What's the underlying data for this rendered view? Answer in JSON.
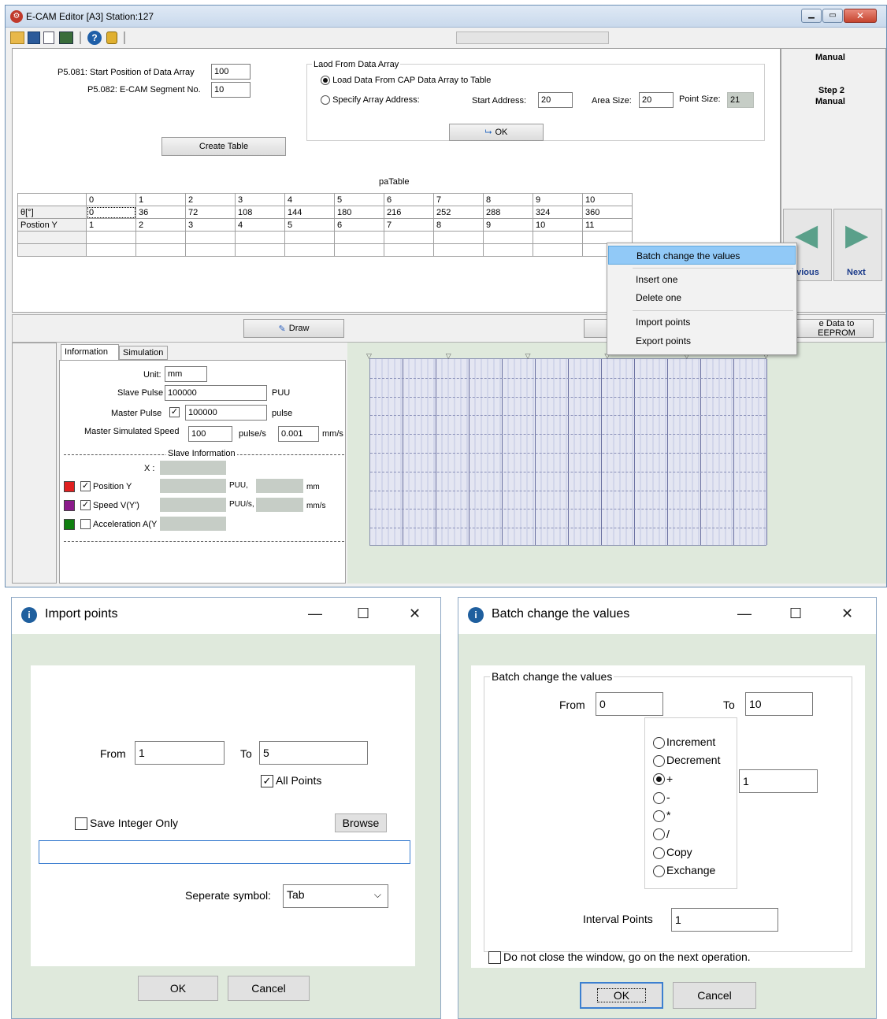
{
  "main": {
    "title": "E-CAM Editor [A3] Station:127",
    "p5081_label": "P5.081: Start Position of Data Array",
    "p5081_value": "100",
    "p5082_label": "P5.082: E-CAM Segment No.",
    "p5082_value": "10",
    "create_table": "Create Table",
    "load_group_title": "Laod From Data Array",
    "load_cap_label": "Load Data From CAP Data Array to Table",
    "specify_label": "Specify Array Address:",
    "start_addr_label": "Start Address:",
    "start_addr_value": "20",
    "area_size_label": "Area Size:",
    "area_size_value": "20",
    "point_size_label": "Point Size:",
    "point_size_value": "21",
    "ok_label": "OK",
    "right_panel_title": "Manual",
    "step_title": "Step 2",
    "step_sub": "Manual",
    "previous_label": "evious",
    "next_label": "Next",
    "table_title": "paTable",
    "draw_label": "Draw",
    "eeprom_label": "e Data to EEPROM"
  },
  "table": {
    "columns": [
      "0",
      "1",
      "2",
      "3",
      "4",
      "5",
      "6",
      "7",
      "8",
      "9",
      "10"
    ],
    "row1_label": "θ[°]",
    "row1": [
      "0",
      "36",
      "72",
      "108",
      "144",
      "180",
      "216",
      "252",
      "288",
      "324",
      "360"
    ],
    "row2_label": "Postion Y",
    "row2": [
      "1",
      "2",
      "3",
      "4",
      "5",
      "6",
      "7",
      "8",
      "9",
      "10",
      "11"
    ]
  },
  "context_menu": {
    "items": [
      "Batch change the values",
      "Insert one",
      "Delete one",
      "Import points",
      "Export points"
    ]
  },
  "info": {
    "tab_information": "Information",
    "tab_simulation": "Simulation",
    "unit_label": "Unit:",
    "unit_value": "mm",
    "slave_pulse_label": "Slave Pulse",
    "slave_pulse_value": "100000",
    "slave_pulse_unit": "PUU",
    "master_pulse_label": "Master Pulse",
    "master_pulse_value": "100000",
    "master_pulse_unit": "pulse",
    "master_speed_label": "Master Simulated Speed",
    "master_speed_value": "100",
    "master_speed_unit": "pulse/s",
    "master_speed_value2": "0.001",
    "master_speed_unit2": "mm/s",
    "slave_info_header": "Slave Information",
    "x_label": "X :",
    "pos_y_label": "Position Y",
    "pos_unit1": "PUU,",
    "pos_unit2": "mm",
    "speed_label": "Speed V(Y')",
    "speed_unit1": "PUU/s,",
    "speed_unit2": "mm/s",
    "accel_label": "Acceleration A(Y",
    "colors": {
      "position": "#e02020",
      "speed": "#8b1a8b",
      "accel": "#108010"
    }
  },
  "import_dialog": {
    "title": "Import points",
    "from_label": "From",
    "from_value": "1",
    "to_label": "To",
    "to_value": "5",
    "all_points": "All Points",
    "save_integer": "Save Integer Only",
    "browse": "Browse",
    "path_value": "",
    "separate_label": "Seperate symbol:",
    "separate_value": "Tab",
    "ok": "OK",
    "cancel": "Cancel"
  },
  "batch_dialog": {
    "title": "Batch change the values",
    "group_title": "Batch change the values",
    "from_label": "From",
    "from_value": "0",
    "to_label": "To",
    "to_value": "10",
    "options": [
      "Increment",
      "Decrement",
      "+",
      "-",
      "*",
      "/",
      "Copy",
      "Exchange"
    ],
    "amount_value": "1",
    "interval_label": "Interval Points",
    "interval_value": "1",
    "keep_open": "Do not close the window, go on the next operation.",
    "ok": "OK",
    "cancel": "Cancel"
  }
}
